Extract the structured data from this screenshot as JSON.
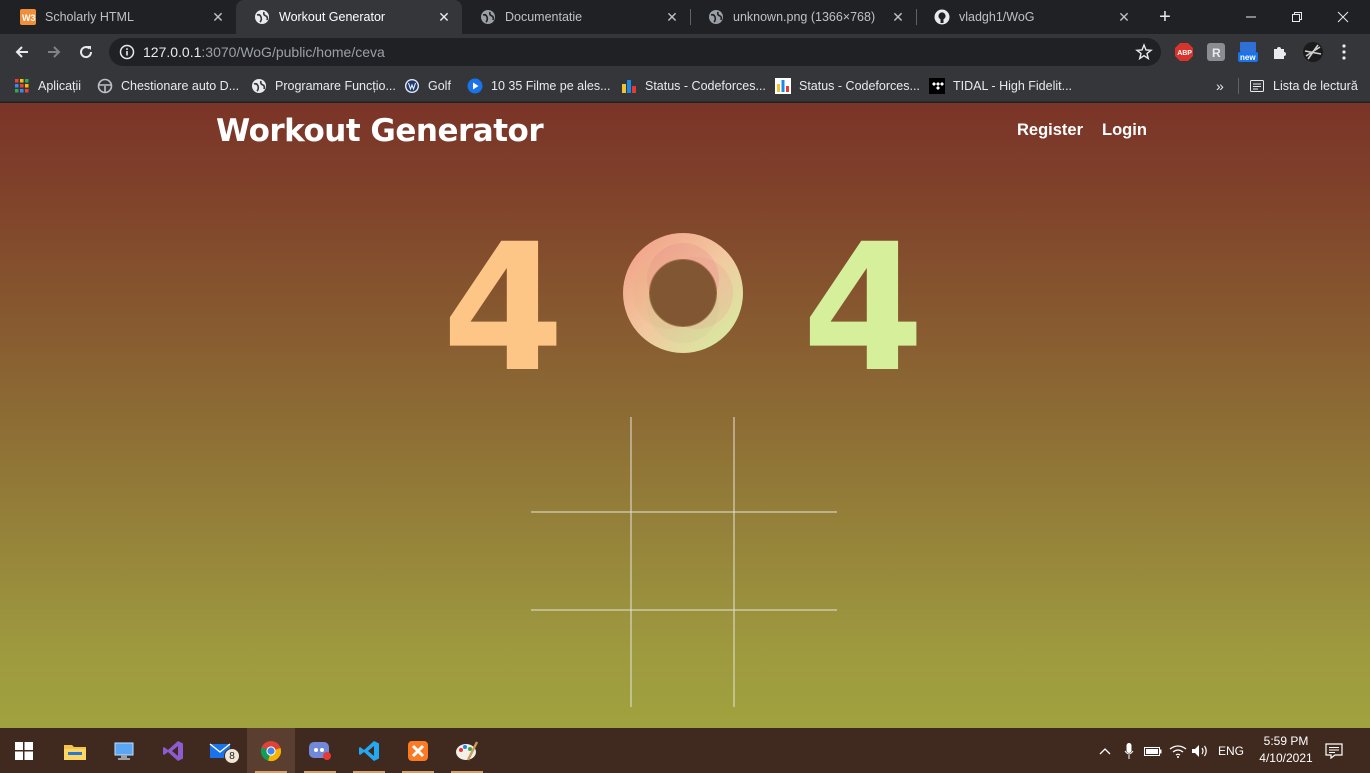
{
  "browser": {
    "tabs": [
      {
        "title": "Scholarly HTML",
        "icon": "w3schools-icon",
        "active": false
      },
      {
        "title": "Workout Generator",
        "icon": "globe-icon",
        "active": true
      },
      {
        "title": "Documentatie",
        "icon": "globe-icon",
        "active": false
      },
      {
        "title": "unknown.png (1366×768)",
        "icon": "globe-icon",
        "active": false
      },
      {
        "title": "vladgh1/WoG",
        "icon": "github-icon",
        "active": false
      }
    ],
    "url_host": "127.0.0.1",
    "url_rest": ":3070/WoG/public/home/ceva",
    "bookmarks": [
      {
        "label": "Aplicații",
        "icon": "apps-grid-icon"
      },
      {
        "label": "Chestionare auto D...",
        "icon": "steering-wheel-icon"
      },
      {
        "label": "Programare Funcțio...",
        "icon": "globe-icon"
      },
      {
        "label": "Golf",
        "icon": "vw-logo-icon"
      },
      {
        "label": "10 35 Filme pe ales...",
        "icon": "play-icon"
      },
      {
        "label": "Status - Codeforces...",
        "icon": "codeforces-icon"
      },
      {
        "label": "Status - Codeforces...",
        "icon": "codeforces-icon"
      },
      {
        "label": "TIDAL - High Fidelit...",
        "icon": "tidal-icon"
      }
    ],
    "reading_list_label": "Lista de lectură",
    "ext_new_badge": "new"
  },
  "site": {
    "brand": "Workout Generator",
    "nav": {
      "register": "Register",
      "login": "Login"
    },
    "error": {
      "first_digit": "4",
      "last_digit": "4"
    },
    "colors": {
      "digit_left": "#fdc586",
      "digit_right": "#d6ef9a",
      "ring_pink": "#e78a8a"
    }
  },
  "taskbar": {
    "apps": [
      "windows-start-icon",
      "file-explorer-icon",
      "this-pc-icon",
      "visual-studio-icon",
      "mail-icon",
      "chrome-icon",
      "discord-icon",
      "vscode-icon",
      "xampp-icon",
      "paint-icon"
    ],
    "mail_badge": "8",
    "language": "ENG",
    "time": "5:59 PM",
    "date": "4/10/2021"
  }
}
